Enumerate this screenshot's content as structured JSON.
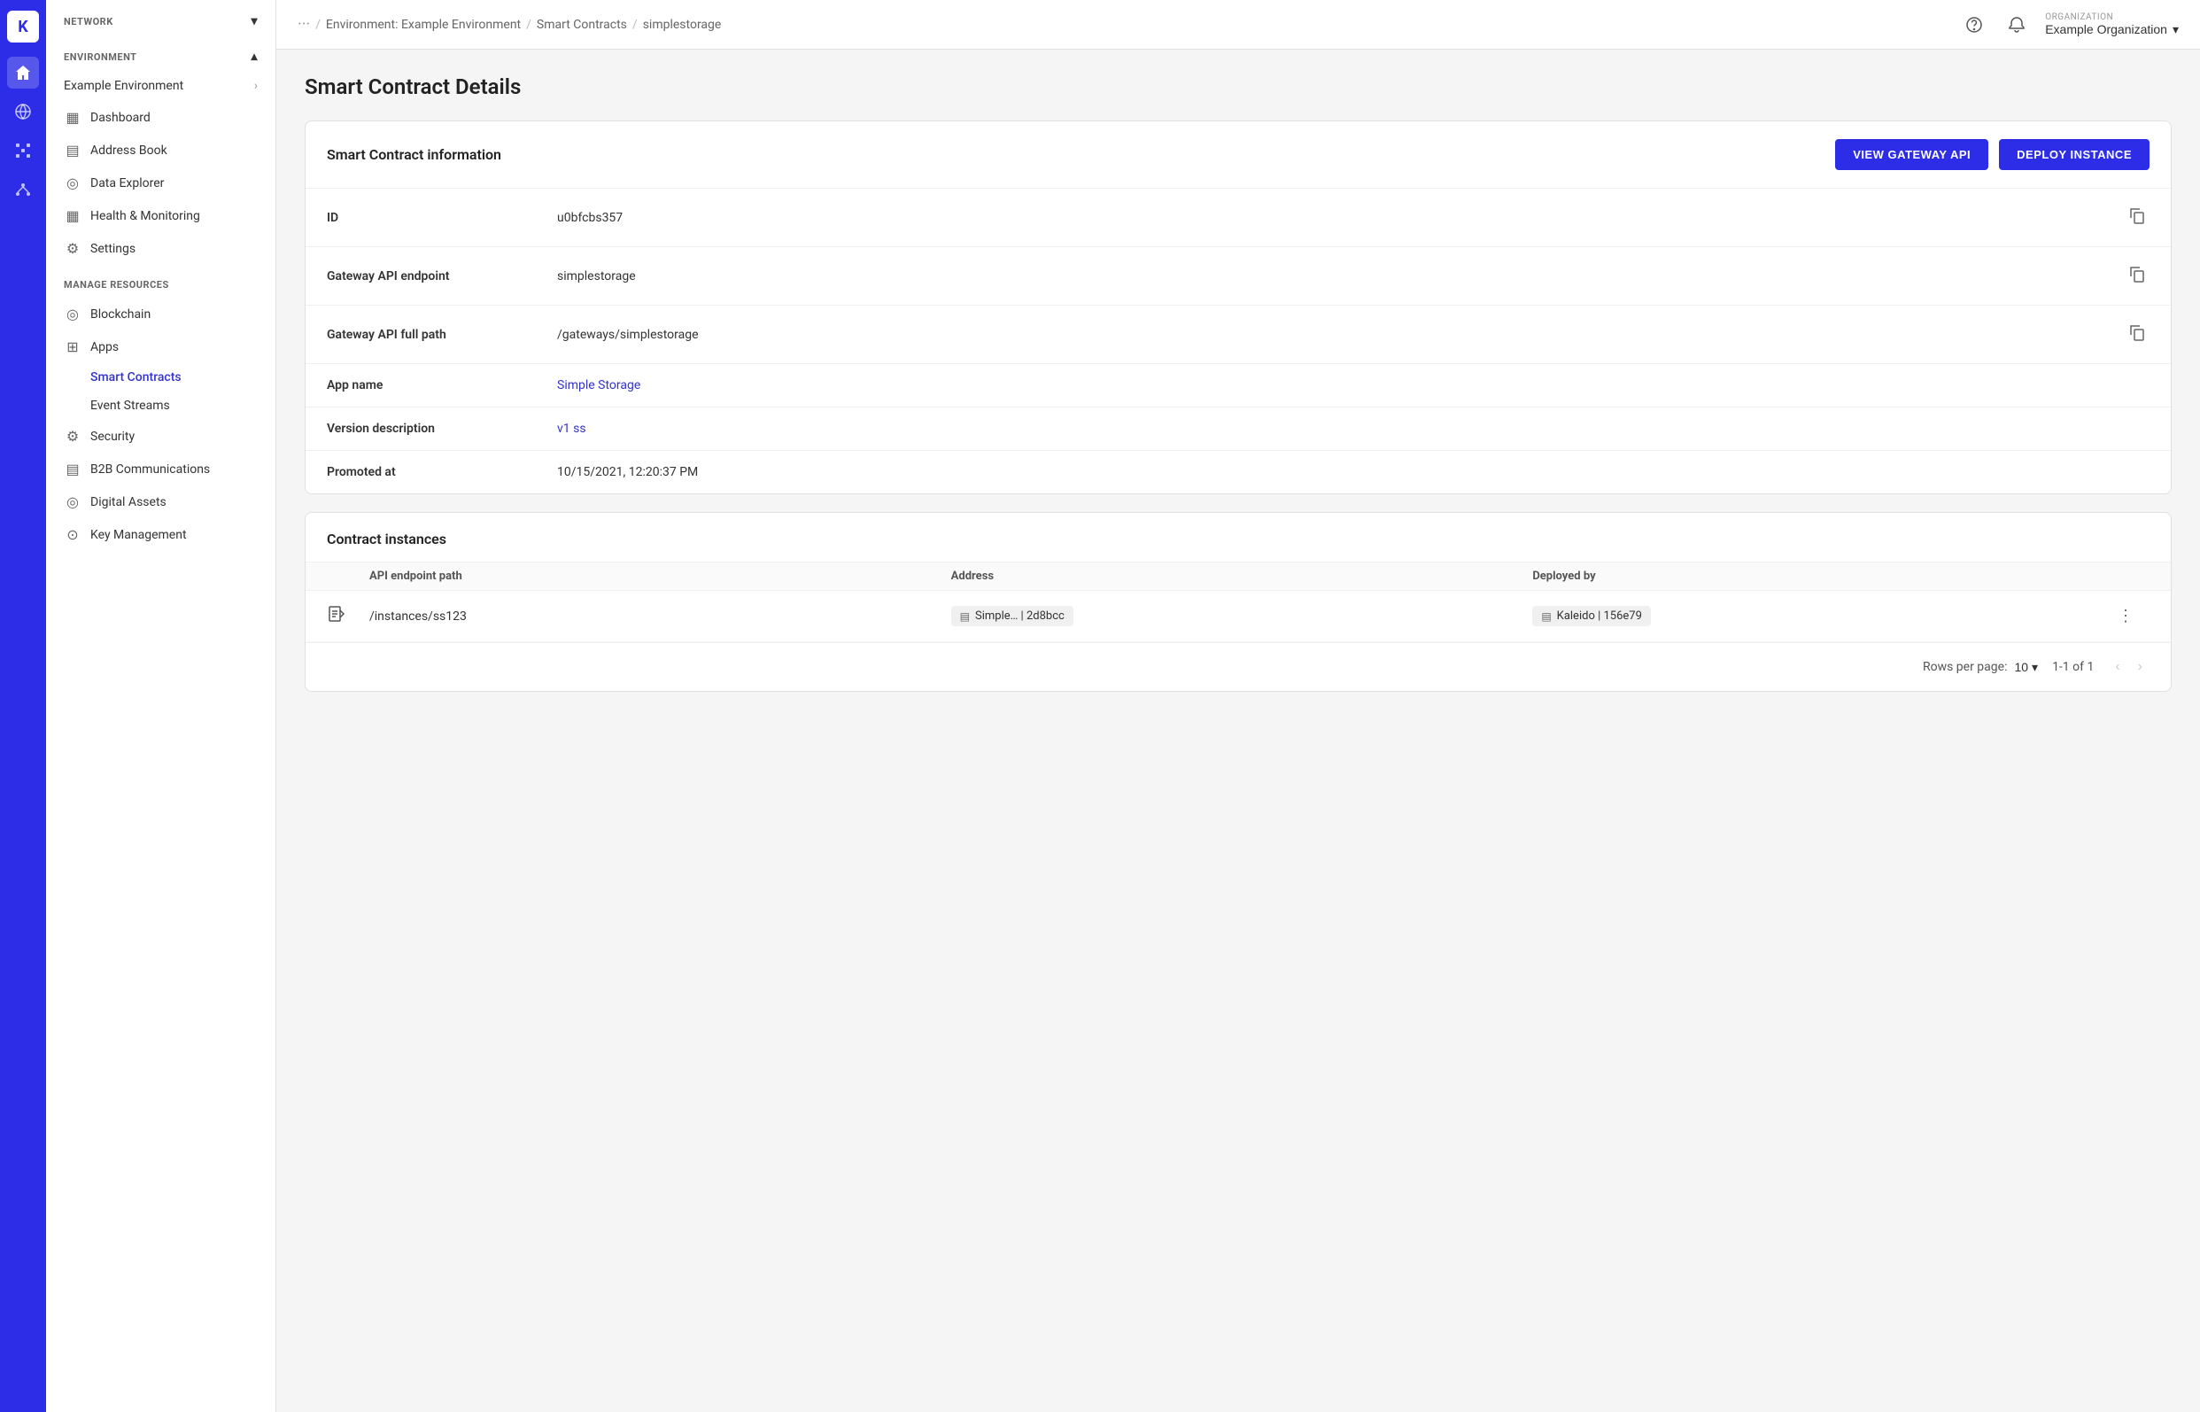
{
  "app": {
    "logo_text": "kaleido"
  },
  "icon_bar": {
    "items": [
      {
        "name": "home",
        "icon": "⌂",
        "active": true
      },
      {
        "name": "globe",
        "icon": "🌐",
        "active": false
      },
      {
        "name": "network",
        "icon": "⬡",
        "active": false
      },
      {
        "name": "nodes",
        "icon": "⊞",
        "active": false
      }
    ]
  },
  "sidebar": {
    "network_label": "NETWORK",
    "environment_label": "ENVIRONMENT",
    "environment_name": "Example Environment",
    "env_items": [
      {
        "label": "Dashboard",
        "icon": "▦",
        "active": false
      },
      {
        "label": "Address Book",
        "icon": "▤",
        "active": false
      },
      {
        "label": "Data Explorer",
        "icon": "◎",
        "active": false
      },
      {
        "label": "Health & Monitoring",
        "icon": "▦",
        "active": false
      },
      {
        "label": "Settings",
        "icon": "⚙",
        "active": false
      }
    ],
    "manage_resources_label": "MANAGE RESOURCES",
    "resource_items": [
      {
        "label": "Blockchain",
        "icon": "◎",
        "active": false
      },
      {
        "label": "Apps",
        "icon": "⊞",
        "active": false
      },
      {
        "label": "Smart Contracts",
        "active": true
      },
      {
        "label": "Event Streams",
        "active": false
      },
      {
        "label": "Security",
        "icon": "⚙",
        "active": false
      },
      {
        "label": "B2B Communications",
        "icon": "▤",
        "active": false
      },
      {
        "label": "Digital Assets",
        "icon": "◎",
        "active": false
      },
      {
        "label": "Key Management",
        "icon": "⊙",
        "active": false
      }
    ]
  },
  "header": {
    "dots": "···",
    "breadcrumb": [
      {
        "label": "Environment: Example Environment"
      },
      {
        "label": "Smart Contracts"
      },
      {
        "label": "simplestorage"
      }
    ],
    "org_label": "ORGANIZATION",
    "org_name": "Example Organization"
  },
  "page": {
    "title": "Smart Contract Details"
  },
  "contract_info": {
    "section_title": "Smart Contract information",
    "btn_view_api": "VIEW GATEWAY API",
    "btn_deploy": "DEPLOY INSTANCE",
    "fields": [
      {
        "label": "ID",
        "value": "u0bfcbs357",
        "copyable": true,
        "link": false
      },
      {
        "label": "Gateway API endpoint",
        "value": "simplestorage",
        "copyable": true,
        "link": false
      },
      {
        "label": "Gateway API full path",
        "value": "/gateways/simplestorage",
        "copyable": true,
        "link": false
      },
      {
        "label": "App name",
        "value": "Simple Storage",
        "copyable": false,
        "link": true
      },
      {
        "label": "Version description",
        "value": "v1 ss",
        "copyable": false,
        "link": true
      },
      {
        "label": "Promoted at",
        "value": "10/15/2021, 12:20:37 PM",
        "copyable": false,
        "link": false
      }
    ]
  },
  "contract_instances": {
    "section_title": "Contract instances",
    "table_headers": [
      "",
      "API endpoint path",
      "Address",
      "Deployed by",
      ""
    ],
    "rows": [
      {
        "icon": "📋",
        "api_path": "/instances/ss123",
        "address_badge": "Simple… | 2d8bcc",
        "deployed_badge": "Kaleido | 156e79"
      }
    ],
    "pagination": {
      "rows_label": "Rows per page:",
      "rows_value": "10",
      "page_info": "1-1 of 1"
    }
  }
}
